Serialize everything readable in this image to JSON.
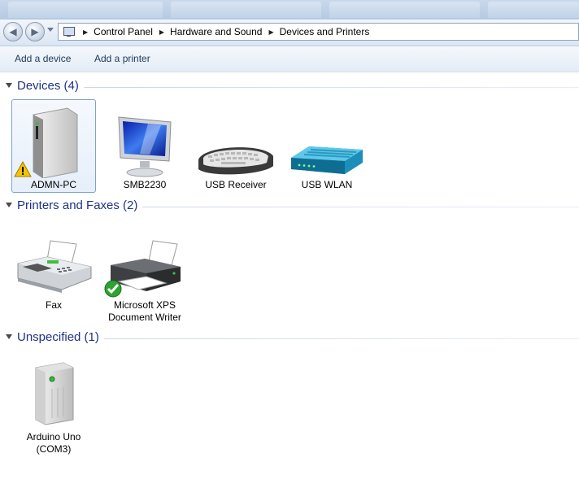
{
  "breadcrumb": [
    "Control Panel",
    "Hardware and Sound",
    "Devices and Printers"
  ],
  "toolbar": {
    "add_device": "Add a device",
    "add_printer": "Add a printer"
  },
  "groups": {
    "devices": {
      "title": "Devices (4)",
      "items": [
        "ADMN-PC",
        "SMB2230",
        "USB Receiver",
        "USB WLAN"
      ]
    },
    "printers": {
      "title": "Printers and Faxes (2)",
      "items": [
        "Fax",
        "Microsoft XPS",
        "Document Writer"
      ]
    },
    "unspecified": {
      "title": "Unspecified (1)",
      "items": [
        "Arduino Uno",
        "(COM3)"
      ]
    }
  },
  "icons": {
    "back": "back-arrow-icon",
    "forward": "forward-arrow-icon",
    "warning": "warning-icon",
    "default": "default-check-icon"
  },
  "colors": {
    "group_title": "#1e3287",
    "command_text": "#1e395b",
    "selection_border": "#7da2ce"
  }
}
